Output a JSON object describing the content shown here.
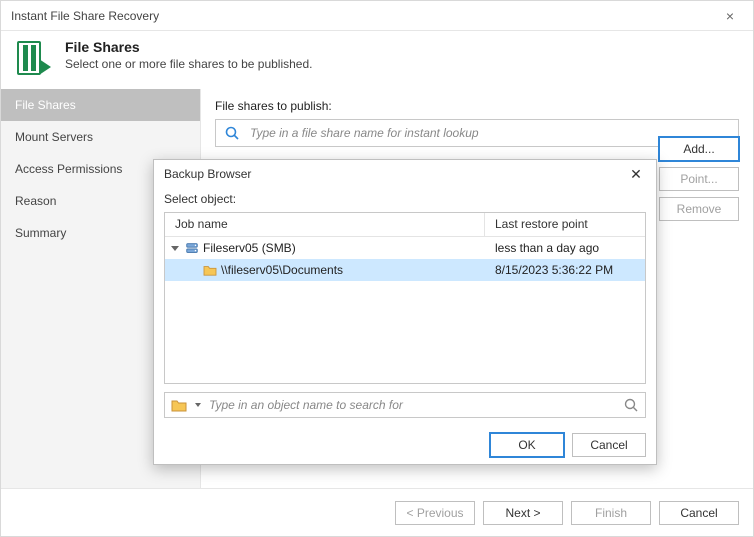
{
  "window": {
    "title": "Instant File Share Recovery"
  },
  "header": {
    "title": "File Shares",
    "subtitle": "Select one or more file shares to be published."
  },
  "steps": [
    {
      "label": "File Shares",
      "active": true
    },
    {
      "label": "Mount Servers",
      "active": false
    },
    {
      "label": "Access Permissions",
      "active": false
    },
    {
      "label": "Reason",
      "active": false
    },
    {
      "label": "Summary",
      "active": false
    }
  ],
  "main": {
    "label": "File shares to publish:",
    "search_placeholder": "Type in a file share name for instant lookup",
    "buttons": {
      "add": "Add...",
      "point": "Point...",
      "remove": "Remove"
    }
  },
  "footer": {
    "previous": "< Previous",
    "next": "Next >",
    "finish": "Finish",
    "cancel": "Cancel"
  },
  "modal": {
    "title": "Backup Browser",
    "prompt": "Select object:",
    "columns": {
      "job": "Job name",
      "restore": "Last restore point"
    },
    "rows": [
      {
        "type": "server",
        "name": "Fileserv05 (SMB)",
        "restore": "less than a day ago",
        "selected": false
      },
      {
        "type": "share",
        "name": "\\\\fileserv05\\Documents",
        "restore": "8/15/2023 5:36:22 PM",
        "selected": true
      }
    ],
    "search_placeholder": "Type in an object name to search for",
    "ok": "OK",
    "cancel": "Cancel"
  }
}
